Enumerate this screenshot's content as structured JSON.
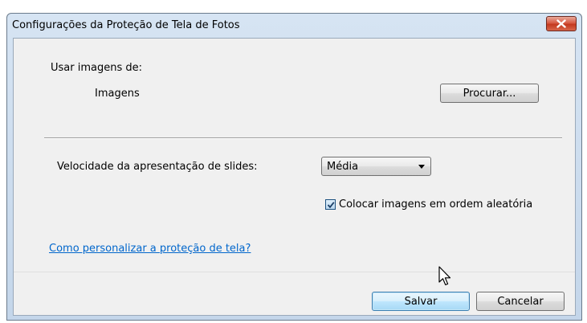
{
  "window": {
    "title": "Configurações da Proteção de Tela de Fotos",
    "close_icon": "close-x-icon"
  },
  "source": {
    "label": "Usar imagens de:",
    "folder": "Imagens",
    "browse_label": "Procurar..."
  },
  "speed": {
    "label": "Velocidade da apresentação de slides:",
    "selected": "Média"
  },
  "shuffle": {
    "label": "Colocar imagens em ordem aleatória",
    "checked": true
  },
  "help_link": "Como personalizar a proteção de tela?",
  "buttons": {
    "save": "Salvar",
    "cancel": "Cancelar"
  },
  "colors": {
    "link": "#0066cc",
    "close_button": "#c3391f",
    "frame": "#c4d6ea"
  }
}
